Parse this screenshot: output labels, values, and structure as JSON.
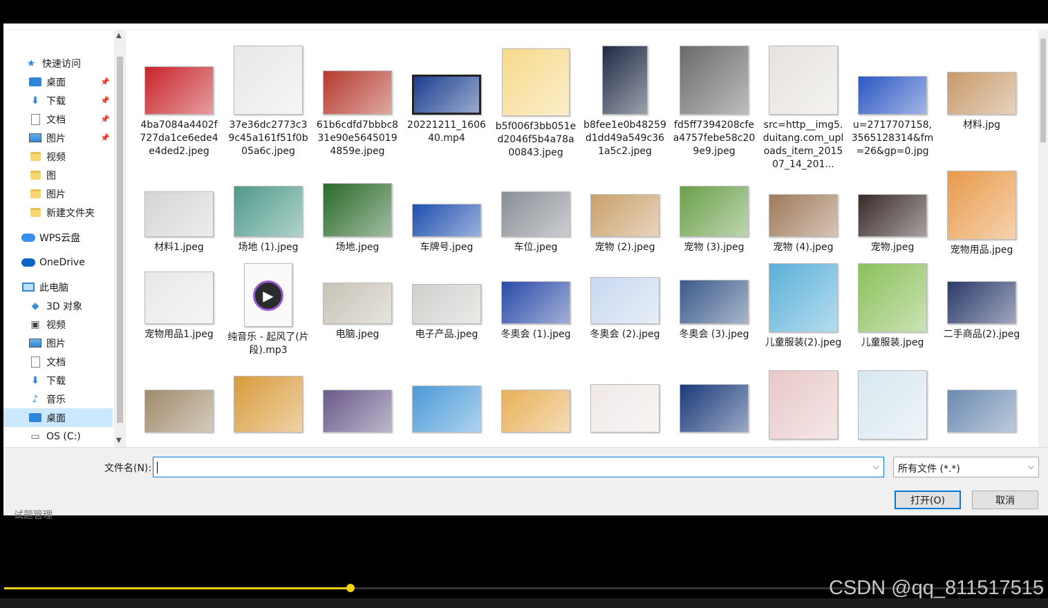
{
  "sidebar": {
    "items": [
      {
        "label": "快速访问",
        "icon": "star-icon",
        "pinned": false
      },
      {
        "label": "桌面",
        "icon": "desktop-icon",
        "pinned": true
      },
      {
        "label": "下载",
        "icon": "download-icon",
        "pinned": true
      },
      {
        "label": "文档",
        "icon": "document-icon",
        "pinned": true
      },
      {
        "label": "图片",
        "icon": "picture-icon",
        "pinned": true
      },
      {
        "label": "视频",
        "icon": "folder-icon",
        "pinned": false
      },
      {
        "label": "图",
        "icon": "folder-icon",
        "pinned": false
      },
      {
        "label": "图片",
        "icon": "folder-icon",
        "pinned": false
      },
      {
        "label": "新建文件夹",
        "icon": "folder-icon",
        "pinned": false
      },
      {
        "label": "WPS云盘",
        "icon": "wps-cloud-icon",
        "pinned": false
      },
      {
        "label": "OneDrive",
        "icon": "onedrive-cloud-icon",
        "pinned": false
      },
      {
        "label": "此电脑",
        "icon": "computer-icon",
        "pinned": false
      },
      {
        "label": "3D 对象",
        "icon": "cube-3d-icon",
        "pinned": false
      },
      {
        "label": "视频",
        "icon": "video-icon",
        "pinned": false
      },
      {
        "label": "图片",
        "icon": "picture-icon",
        "pinned": false
      },
      {
        "label": "文档",
        "icon": "document-icon",
        "pinned": false
      },
      {
        "label": "下载",
        "icon": "download-icon",
        "pinned": false
      },
      {
        "label": "音乐",
        "icon": "music-icon",
        "pinned": false
      },
      {
        "label": "桌面",
        "icon": "desktop-icon",
        "pinned": false,
        "selected": true
      },
      {
        "label": "OS (C:)",
        "icon": "drive-icon",
        "pinned": false
      }
    ],
    "pin_glyph": "📌"
  },
  "files": [
    {
      "name": "4ba7084a4402f727da1ce6ede4e4ded2.jpeg",
      "color": "#c8242b"
    },
    {
      "name": "37e36dc2773c39c45a161f51f0b05a6c.jpeg",
      "color": "#e8e8e8"
    },
    {
      "name": "61b6cdfd7bbbc831e90e56450194859e.jpeg",
      "color": "#b53a2e"
    },
    {
      "name": "20221211_160640.mp4",
      "color": "#1b3f8f"
    },
    {
      "name": "b5f006f3bb051ed2046f5b4a78a00843.jpeg",
      "color": "#f6d98a"
    },
    {
      "name": "b8fee1e0b48259d1dd49a549c361a5c2.jpeg",
      "color": "#1f2a44"
    },
    {
      "name": "fd5ff7394208cfea4757febe58c209e9.jpeg",
      "color": "#6a6a6a"
    },
    {
      "name": "src=http__img5.duitang.com_uploads_item_201507_14_201...",
      "color": "#e6e3de"
    },
    {
      "name": "u=2717707158,3565128314&fm=26&gp=0.jpg",
      "color": "#2c58c4"
    },
    {
      "name": "材料.jpg",
      "color": "#c79a6a"
    },
    {
      "name": "材料1.jpeg",
      "color": "#d5d5d5"
    },
    {
      "name": "场地 (1).jpeg",
      "color": "#4f9a8a"
    },
    {
      "name": "场地.jpeg",
      "color": "#2a6a2a"
    },
    {
      "name": "车牌号.jpeg",
      "color": "#1f4fb0"
    },
    {
      "name": "车位.jpeg",
      "color": "#8a8f96"
    },
    {
      "name": "宠物 (2).jpeg",
      "color": "#c9a06a"
    },
    {
      "name": "宠物 (3).jpeg",
      "color": "#6aa04a"
    },
    {
      "name": "宠物 (4).jpeg",
      "color": "#a07a5a"
    },
    {
      "name": "宠物.jpeg",
      "color": "#3a2a2a"
    },
    {
      "name": "宠物用品.jpeg",
      "color": "#e89a4a"
    },
    {
      "name": "宠物用品1.jpeg",
      "color": "#e8e8e8"
    },
    {
      "name": "纯音乐 - 起风了(片段).mp3",
      "color": "#f4f4f4"
    },
    {
      "name": "电脑.jpeg",
      "color": "#c8c2b6"
    },
    {
      "name": "电子产品.jpeg",
      "color": "#d0cfcc"
    },
    {
      "name": "冬奥会 (1).jpeg",
      "color": "#2a4aa8"
    },
    {
      "name": "冬奥会 (2).jpeg",
      "color": "#c8d8f0"
    },
    {
      "name": "冬奥会 (3).jpeg",
      "color": "#3a5a8a"
    },
    {
      "name": "儿童服装(2).jpeg",
      "color": "#5ab0d8"
    },
    {
      "name": "儿童服装.jpeg",
      "color": "#8ac05a"
    },
    {
      "name": "二手商品(2).jpeg",
      "color": "#2a3a6a"
    },
    {
      "name": "",
      "color": "#a08a6a"
    },
    {
      "name": "",
      "color": "#d89a3a"
    },
    {
      "name": "",
      "color": "#6a5a8a"
    },
    {
      "name": "",
      "color": "#4a9ad8"
    },
    {
      "name": "",
      "color": "#e8b05a"
    },
    {
      "name": "",
      "color": "#f0e8e8"
    },
    {
      "name": "",
      "color": "#1a3a7a"
    },
    {
      "name": "",
      "color": "#e8c8c8"
    },
    {
      "name": "",
      "color": "#d8e8f0"
    },
    {
      "name": "",
      "color": "#6a8ab0"
    }
  ],
  "bottom": {
    "filename_label": "文件名(N):",
    "filename_value": "",
    "filetype_value": "所有文件 (*.*)",
    "open_label": "打开(O)",
    "cancel_label": "取消",
    "dropdown_glyph": "⌵"
  },
  "behind_text": "试题管理",
  "video": {
    "progress": 0.333,
    "accent": "#f2d016"
  },
  "watermark": "CSDN @qq_811517515"
}
